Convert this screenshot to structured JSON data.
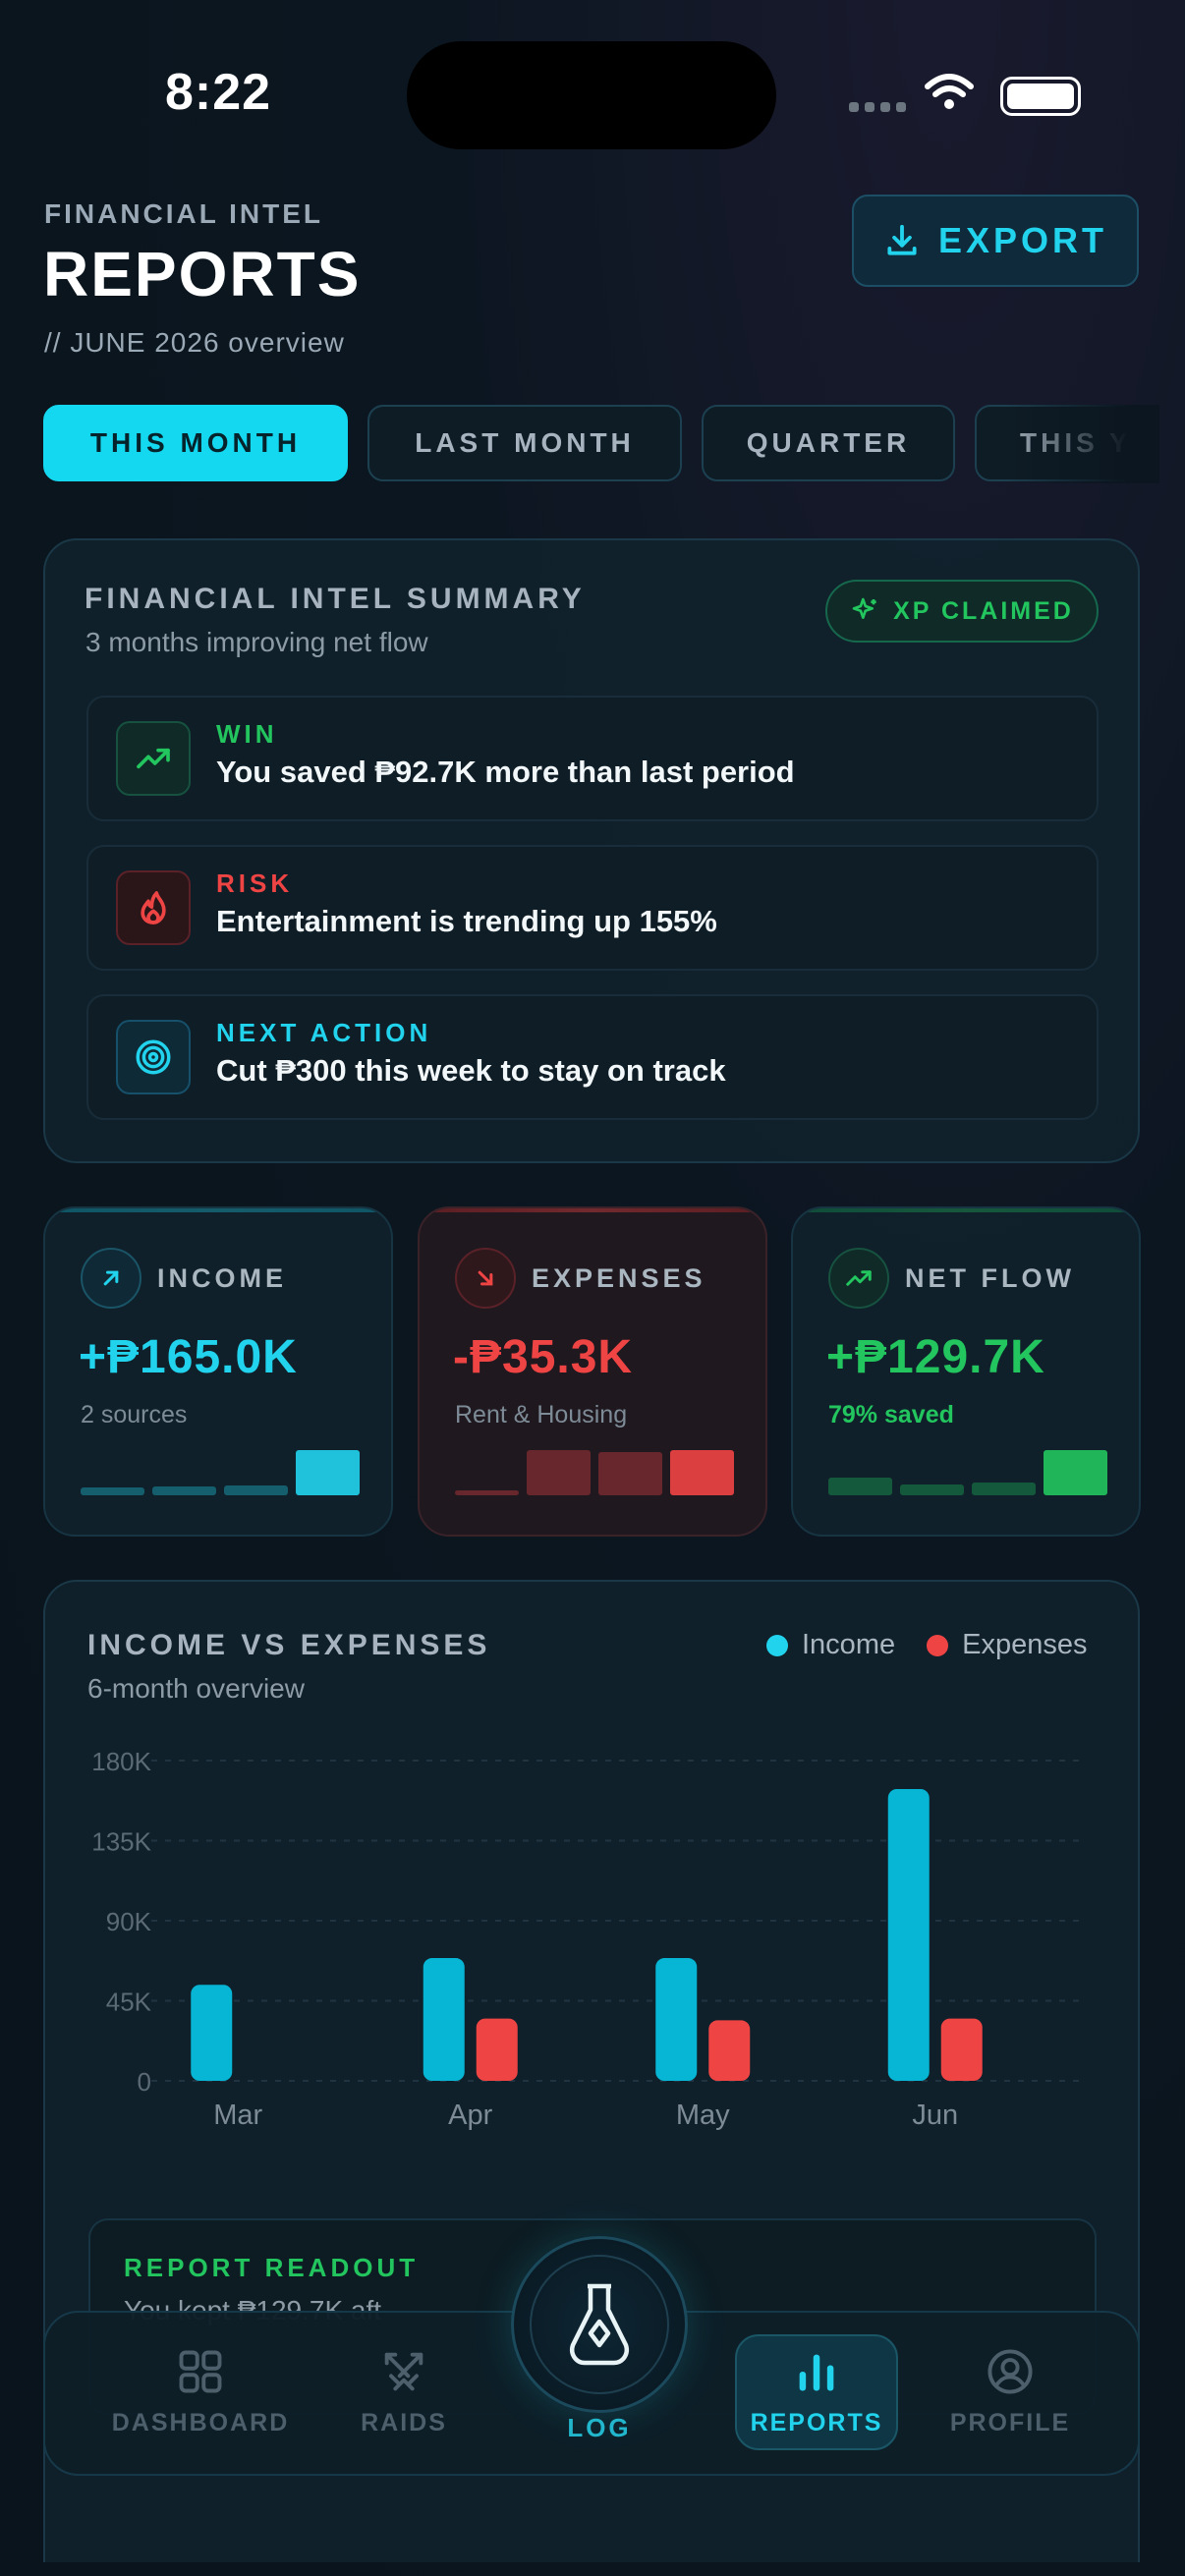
{
  "status_bar": {
    "time": "8:22"
  },
  "header": {
    "eyebrow": "FINANCIAL INTEL",
    "title": "REPORTS",
    "subtitle": "// JUNE 2026 overview",
    "export_label": "EXPORT"
  },
  "tabs": [
    {
      "label": "THIS MONTH",
      "active": true
    },
    {
      "label": "LAST MONTH",
      "active": false
    },
    {
      "label": "QUARTER",
      "active": false
    },
    {
      "label": "THIS Y",
      "active": false
    }
  ],
  "summary": {
    "title": "FINANCIAL INTEL SUMMARY",
    "subtitle": "3 months improving net flow",
    "badge": "XP CLAIMED",
    "insights": [
      {
        "label": "WIN",
        "text": "You saved ₱92.7K more than last period",
        "icon": "trending-up-icon",
        "color": "#22c55e"
      },
      {
        "label": "RISK",
        "text": "Entertainment is trending up 155%",
        "icon": "flame-icon",
        "color": "#ef4444"
      },
      {
        "label": "NEXT ACTION",
        "text": "Cut ₱300 this week to stay on track",
        "icon": "target-icon",
        "color": "#22d3ee"
      }
    ]
  },
  "stats": [
    {
      "label": "INCOME",
      "value": "+₱165.0K",
      "sub": "2 sources",
      "icon": "arrow-up-right-icon",
      "color": "#22d3ee",
      "spark": [
        0.18,
        0.2,
        0.22,
        1.0
      ]
    },
    {
      "label": "EXPENSES",
      "value": "-₱35.3K",
      "sub": "Rent & Housing",
      "icon": "arrow-down-right-icon",
      "color": "#ef4444",
      "spark": [
        0.1,
        1.0,
        0.95,
        1.0
      ]
    },
    {
      "label": "NET FLOW",
      "value": "+₱129.7K",
      "sub": "79% saved",
      "icon": "trending-up-icon",
      "color": "#22c55e",
      "spark": [
        0.4,
        0.25,
        0.28,
        1.0
      ]
    }
  ],
  "chart_data": {
    "type": "bar",
    "title": "INCOME VS EXPENSES",
    "subtitle": "6-month overview",
    "categories": [
      "Mar",
      "Apr",
      "May",
      "Jun"
    ],
    "series": [
      {
        "name": "Income",
        "color": "#06b6d4",
        "values": [
          54,
          69,
          69,
          164
        ]
      },
      {
        "name": "Expenses",
        "color": "#ef4444",
        "values": [
          0,
          35,
          34,
          35
        ]
      }
    ],
    "y_ticks": [
      "0",
      "45K",
      "90K",
      "135K",
      "180K"
    ],
    "ylim": [
      0,
      180
    ],
    "grid": true,
    "legend": "top-right"
  },
  "readout": {
    "title": "REPORT READOUT",
    "text": "You kept ₱129.7K aft"
  },
  "nav": {
    "items": [
      {
        "label": "DASHBOARD",
        "icon": "grid-icon"
      },
      {
        "label": "RAIDS",
        "icon": "swords-icon"
      },
      {
        "label": "LOG",
        "icon": "potion-icon"
      },
      {
        "label": "REPORTS",
        "icon": "bar-chart-icon",
        "active": true
      },
      {
        "label": "PROFILE",
        "icon": "user-circle-icon"
      }
    ]
  }
}
